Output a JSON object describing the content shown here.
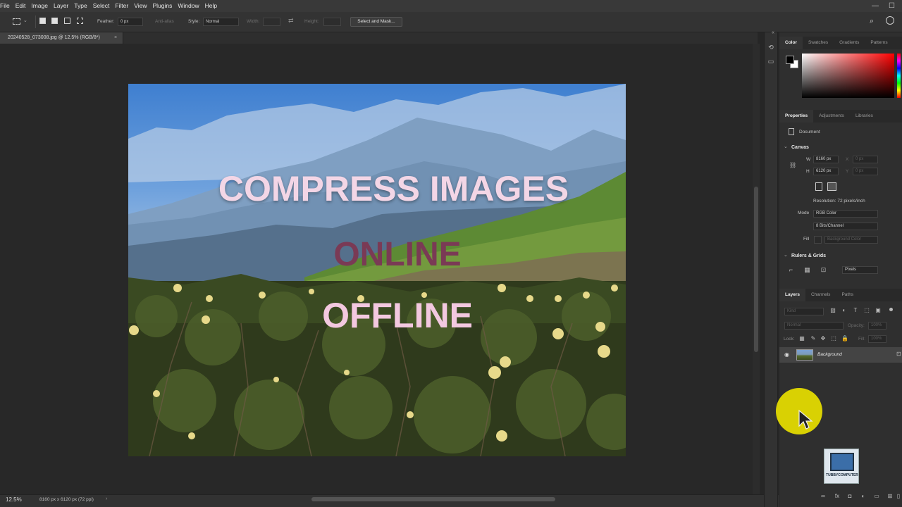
{
  "menubar": {
    "items": [
      "File",
      "Edit",
      "Image",
      "Layer",
      "Type",
      "Select",
      "Filter",
      "View",
      "Plugins",
      "Window",
      "Help"
    ]
  },
  "options": {
    "feather_label": "Feather:",
    "feather_value": "0 px",
    "antialias_label": "Anti-alias",
    "style_label": "Style:",
    "style_value": "Normal",
    "width_label": "Width:",
    "height_label": "Height:",
    "select_mask_label": "Select and Mask..."
  },
  "document": {
    "tab_title": "20240528_073008.jpg @ 12.5% (RGB/8*)",
    "tab_close": "×",
    "overlay": {
      "line1": "COMPRESS IMAGES",
      "line2": "ONLINE",
      "line3": "OFFLINE"
    }
  },
  "status": {
    "zoom": "12.5%",
    "doc_info": "8160 px x 6120 px (72 ppi)"
  },
  "color_panel": {
    "tabs": [
      "Color",
      "Swatches",
      "Gradients",
      "Patterns"
    ],
    "active_tab": 0
  },
  "properties_panel": {
    "tabs": [
      "Properties",
      "Adjustments",
      "Libraries"
    ],
    "doc_label": "Document",
    "canvas_title": "Canvas",
    "w_label": "W",
    "w_value": "8160 px",
    "h_label": "H",
    "h_value": "6120 px",
    "x_label": "X",
    "x_value": "0 px",
    "y_label": "Y",
    "y_value": "0 px",
    "resolution": "Resolution: 72 pixels/inch",
    "mode_label": "Mode",
    "mode_value": "RGB Color",
    "bits_value": "8 Bits/Channel",
    "fill_label": "Fill",
    "fill_value": "Background Color",
    "rulers_title": "Rulers & Grids",
    "units_value": "Pixels"
  },
  "layers_panel": {
    "tabs": [
      "Layers",
      "Channels",
      "Paths"
    ],
    "kind_label": "Kind",
    "blend_mode": "Normal",
    "opacity_label": "Opacity:",
    "opacity_value": "100%",
    "lock_label": "Lock:",
    "fill_label": "Fill:",
    "fill_value": "100%",
    "layer_name": "Background"
  },
  "watermark": {
    "text": "TUBBYCOMPUTER"
  },
  "colors": {
    "overlay_text_light": "#f3d6e6",
    "overlay_text_dark": "#7a3a55",
    "cursor_highlight": "#e8e000"
  }
}
